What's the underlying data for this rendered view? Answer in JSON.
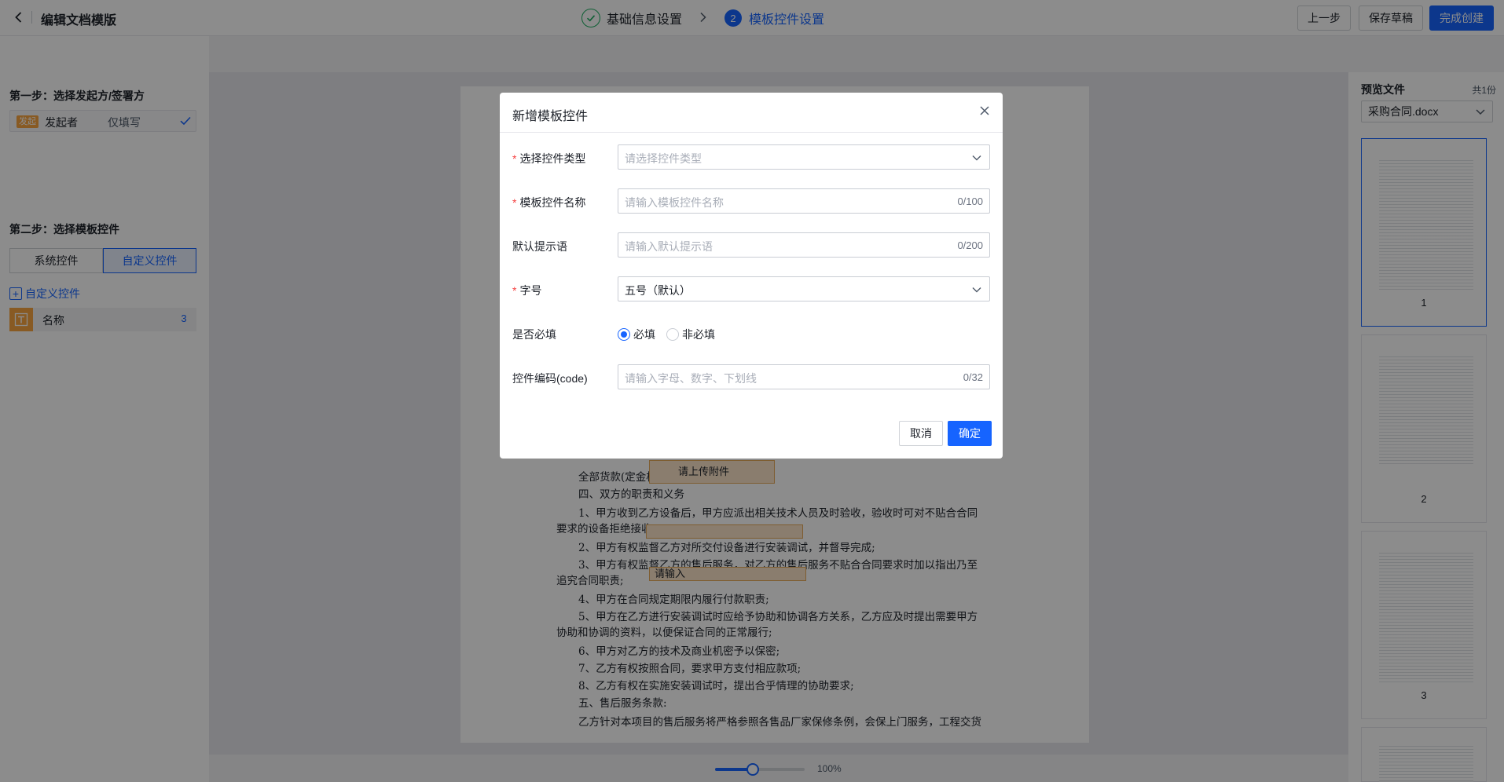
{
  "header": {
    "title": "编辑文档模版",
    "steps": [
      {
        "label": "基础信息设置",
        "status": "done"
      },
      {
        "number": "2",
        "label": "模板控件设置",
        "status": "active"
      }
    ],
    "prev_label": "上一步",
    "save_draft_label": "保存草稿",
    "finish_label": "完成创建"
  },
  "left_panel": {
    "step1_title": "第一步：选择发起方/签署方",
    "signer": {
      "tag": "发起",
      "name": "发起者",
      "mode": "仅填写"
    },
    "step2_title": "第二步：选择模板控件",
    "tabs": [
      {
        "label": "系统控件",
        "active": false
      },
      {
        "label": "自定义控件",
        "active": true
      }
    ],
    "add_custom_label": "自定义控件",
    "controls": [
      {
        "name": "名称",
        "count": "3"
      }
    ]
  },
  "document": {
    "lines": [
      "全部货款(定金相应冲抵货款）。",
      "四、双方的职责和义务",
      "1、甲方收到乙方设备后，甲方应派出相关技术人员及时验收，验收时可对不贴合合同",
      "要求的设备拒绝接收;",
      "2、甲方有权监督乙方对所交付设备进行安装调试，并督导完成;",
      "3、甲方有权监督乙方的售后服务，对乙方的售后服务不贴合合同要求时加以指出乃至",
      "追究合同职责;",
      "4、甲方在合同规定期限内履行付款职责;",
      "5、甲方在乙方进行安装调试时应给予协助和协调各方关系，乙方应及时提出需要甲方",
      "协助和协调的资料，以便保证合同的正常履行;",
      "6、甲方对乙方的技术及商业机密予以保密;",
      "7、乙方有权按照合同，要求甲方支付相应款项;",
      "8、乙方有权在实施安装调试时，提出合乎情理的协助要求;",
      "五、售后服务条款:",
      "乙方针对本项目的售后服务将严格参照各售品厂家保修条例，会保上门服务，工程交货"
    ],
    "fields": [
      {
        "label": "请上传附件"
      },
      {
        "label": ""
      },
      {
        "label": "请输入"
      }
    ]
  },
  "zoom": {
    "label": "100%",
    "value": 0.42
  },
  "right_panel": {
    "title": "预览文件",
    "count": "共1份",
    "file_name": "采购合同.docx",
    "pages": [
      "1",
      "2",
      "3"
    ]
  },
  "modal": {
    "title": "新增模板控件",
    "fields": {
      "type": {
        "label": "选择控件类型",
        "placeholder": "请选择控件类型",
        "required": true
      },
      "name": {
        "label": "模板控件名称",
        "placeholder": "请输入模板控件名称",
        "counter": "0/100",
        "required": true
      },
      "hint": {
        "label": "默认提示语",
        "placeholder": "请输入默认提示语",
        "counter": "0/200",
        "required": false
      },
      "font_size": {
        "label": "字号",
        "value": "五号（默认）",
        "required": true
      },
      "required_field": {
        "label": "是否必填",
        "options": [
          "必填",
          "非必填"
        ],
        "selected": "必填"
      },
      "code": {
        "label": "控件编码(code)",
        "placeholder": "请输入字母、数字、下划线",
        "counter": "0/32"
      }
    },
    "cancel_label": "取消",
    "confirm_label": "确定"
  },
  "colors": {
    "primary": "#1664ff",
    "success": "#1aae60",
    "warning_tag": "#f7a440",
    "required": "#f53f3f"
  }
}
